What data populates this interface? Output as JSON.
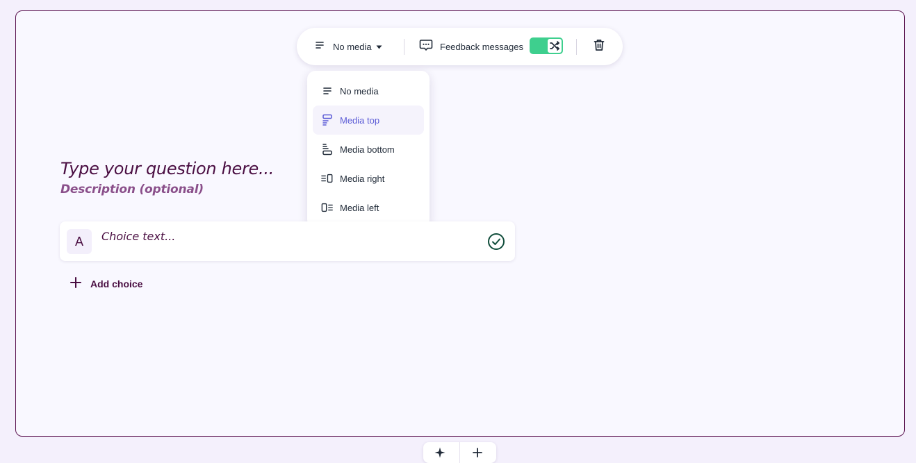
{
  "toolbar": {
    "media_label": "No media",
    "feedback_label": "Feedback messages",
    "feedback_enabled": true
  },
  "media_menu": {
    "items": [
      {
        "label": "No media",
        "icon": "lines-icon",
        "selected": false
      },
      {
        "label": "Media top",
        "icon": "media-top-icon",
        "selected": true
      },
      {
        "label": "Media bottom",
        "icon": "media-bottom-icon",
        "selected": false
      },
      {
        "label": "Media right",
        "icon": "media-right-icon",
        "selected": false
      },
      {
        "label": "Media left",
        "icon": "media-left-icon",
        "selected": false
      }
    ]
  },
  "question": {
    "title_placeholder": "Type your question here...",
    "description_placeholder": "Description (optional)"
  },
  "choices": [
    {
      "letter": "A",
      "placeholder": "Choice text...",
      "correct": true
    }
  ],
  "add_choice_label": "Add choice",
  "colors": {
    "accent": "#4a0e42",
    "toggle_on": "#3ecf8e",
    "menu_highlight": "#5b5bd6",
    "background": "#f9f8ff"
  }
}
